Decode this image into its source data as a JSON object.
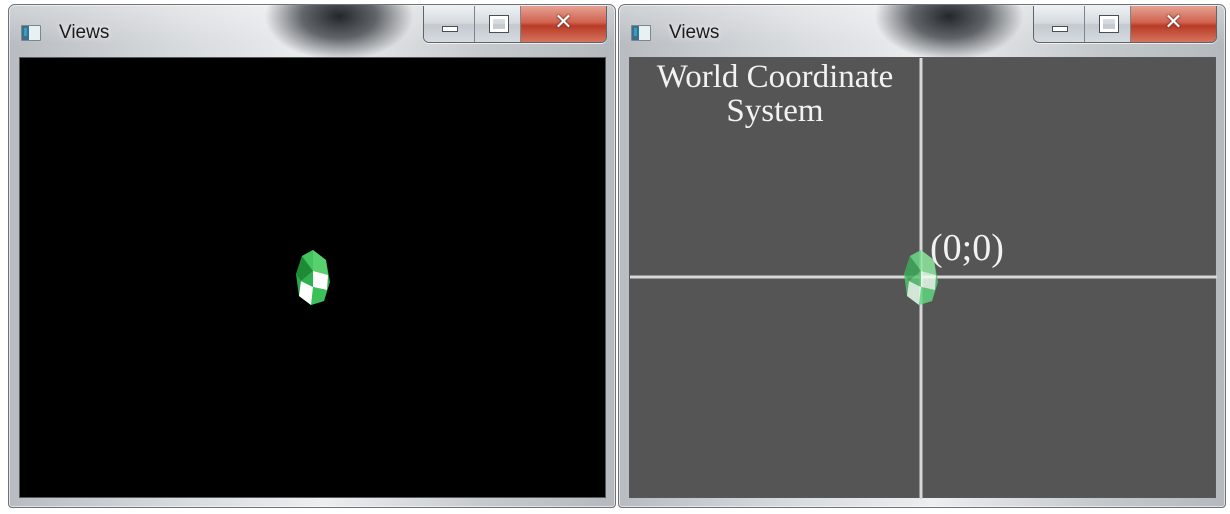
{
  "windows": [
    {
      "title": "Views",
      "icon": "app-window-icon",
      "background": "#000000",
      "buttons": [
        "minimize",
        "maximize",
        "close"
      ]
    },
    {
      "title": "Views",
      "icon": "app-window-icon",
      "background": "#555555",
      "buttons": [
        "minimize",
        "maximize",
        "close"
      ],
      "labels": {
        "world_line1": "World Coordinate",
        "world_line2": "System",
        "origin": "(0;0)"
      }
    }
  ],
  "colors": {
    "object_green": "#3cc15a",
    "object_light": "#9ef0a8",
    "axis_line": "#d8d8d8",
    "close_red": "#c8452f"
  }
}
